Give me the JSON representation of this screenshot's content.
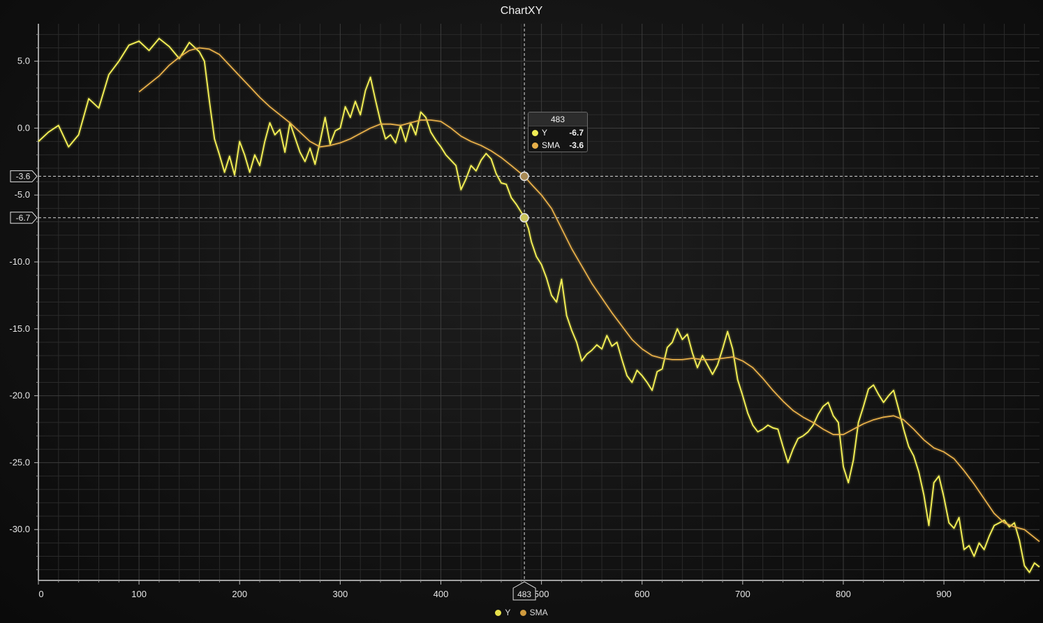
{
  "chart_data": {
    "type": "line",
    "title": "ChartXY",
    "xlim": [
      0,
      995
    ],
    "ylim": [
      -33.8,
      7.8
    ],
    "x_ticks": [
      0,
      100,
      200,
      300,
      400,
      500,
      600,
      700,
      800,
      900
    ],
    "y_ticks": [
      5.0,
      0.0,
      -5.0,
      -10.0,
      -15.0,
      -20.0,
      -25.0,
      -30.0
    ],
    "y_tick_labels": [
      "5.0",
      "0.0",
      "-5.0",
      "-10.0",
      "-15.0",
      "-20.0",
      "-25.0",
      "-30.0"
    ],
    "series": [
      {
        "name": "Y",
        "color": "#f2ee55",
        "points": [
          [
            0,
            -1
          ],
          [
            10,
            -0.3
          ],
          [
            20,
            0.2
          ],
          [
            30,
            -1.4
          ],
          [
            40,
            -0.5
          ],
          [
            50,
            2.2
          ],
          [
            60,
            1.5
          ],
          [
            70,
            4.0
          ],
          [
            80,
            5.0
          ],
          [
            90,
            6.2
          ],
          [
            100,
            6.5
          ],
          [
            110,
            5.8
          ],
          [
            120,
            6.7
          ],
          [
            130,
            6.1
          ],
          [
            140,
            5.2
          ],
          [
            150,
            6.4
          ],
          [
            160,
            5.7
          ],
          [
            165,
            5.0
          ],
          [
            170,
            2.0
          ],
          [
            175,
            -0.8
          ],
          [
            180,
            -2.0
          ],
          [
            185,
            -3.3
          ],
          [
            190,
            -2.1
          ],
          [
            195,
            -3.5
          ],
          [
            200,
            -1.0
          ],
          [
            205,
            -2.0
          ],
          [
            210,
            -3.3
          ],
          [
            215,
            -2.0
          ],
          [
            220,
            -2.8
          ],
          [
            225,
            -1.0
          ],
          [
            230,
            0.4
          ],
          [
            235,
            -0.5
          ],
          [
            240,
            -0.1
          ],
          [
            245,
            -1.8
          ],
          [
            250,
            0.4
          ],
          [
            255,
            -0.7
          ],
          [
            260,
            -1.8
          ],
          [
            265,
            -2.5
          ],
          [
            270,
            -1.5
          ],
          [
            275,
            -2.7
          ],
          [
            280,
            -1.0
          ],
          [
            285,
            0.8
          ],
          [
            290,
            -1.2
          ],
          [
            295,
            -0.2
          ],
          [
            300,
            0.0
          ],
          [
            305,
            1.6
          ],
          [
            310,
            0.8
          ],
          [
            315,
            2.0
          ],
          [
            320,
            1.0
          ],
          [
            325,
            2.8
          ],
          [
            330,
            3.8
          ],
          [
            335,
            2.1
          ],
          [
            340,
            0.5
          ],
          [
            345,
            -0.8
          ],
          [
            350,
            -0.5
          ],
          [
            355,
            -1.1
          ],
          [
            360,
            0.2
          ],
          [
            365,
            -1.0
          ],
          [
            370,
            0.4
          ],
          [
            375,
            -0.5
          ],
          [
            380,
            1.2
          ],
          [
            385,
            0.8
          ],
          [
            390,
            -0.3
          ],
          [
            395,
            -0.9
          ],
          [
            400,
            -1.4
          ],
          [
            405,
            -2.0
          ],
          [
            410,
            -2.4
          ],
          [
            415,
            -2.8
          ],
          [
            420,
            -4.6
          ],
          [
            425,
            -3.8
          ],
          [
            430,
            -2.8
          ],
          [
            435,
            -3.2
          ],
          [
            440,
            -2.4
          ],
          [
            445,
            -1.9
          ],
          [
            450,
            -2.3
          ],
          [
            455,
            -3.4
          ],
          [
            460,
            -4.1
          ],
          [
            465,
            -4.2
          ],
          [
            470,
            -5.2
          ],
          [
            475,
            -5.7
          ],
          [
            480,
            -6.3
          ],
          [
            483,
            -6.7
          ],
          [
            487,
            -7.5
          ],
          [
            490,
            -8.5
          ],
          [
            495,
            -9.6
          ],
          [
            500,
            -10.2
          ],
          [
            505,
            -11.2
          ],
          [
            510,
            -12.5
          ],
          [
            515,
            -13.0
          ],
          [
            520,
            -11.3
          ],
          [
            525,
            -14.0
          ],
          [
            530,
            -15.1
          ],
          [
            535,
            -16.0
          ],
          [
            540,
            -17.4
          ],
          [
            545,
            -16.9
          ],
          [
            550,
            -16.6
          ],
          [
            555,
            -16.2
          ],
          [
            560,
            -16.5
          ],
          [
            565,
            -15.5
          ],
          [
            570,
            -16.3
          ],
          [
            575,
            -16.0
          ],
          [
            580,
            -17.3
          ],
          [
            585,
            -18.5
          ],
          [
            590,
            -19.0
          ],
          [
            595,
            -18.1
          ],
          [
            600,
            -18.5
          ],
          [
            605,
            -19.0
          ],
          [
            610,
            -19.6
          ],
          [
            615,
            -18.2
          ],
          [
            620,
            -18.0
          ],
          [
            625,
            -16.4
          ],
          [
            630,
            -16.0
          ],
          [
            635,
            -15.0
          ],
          [
            640,
            -15.8
          ],
          [
            645,
            -15.4
          ],
          [
            650,
            -16.8
          ],
          [
            655,
            -17.9
          ],
          [
            660,
            -17.0
          ],
          [
            665,
            -17.7
          ],
          [
            670,
            -18.4
          ],
          [
            675,
            -17.7
          ],
          [
            680,
            -16.5
          ],
          [
            685,
            -15.2
          ],
          [
            690,
            -16.5
          ],
          [
            695,
            -18.8
          ],
          [
            700,
            -20.0
          ],
          [
            705,
            -21.3
          ],
          [
            710,
            -22.2
          ],
          [
            715,
            -22.7
          ],
          [
            720,
            -22.5
          ],
          [
            725,
            -22.2
          ],
          [
            730,
            -22.4
          ],
          [
            735,
            -22.5
          ],
          [
            740,
            -23.8
          ],
          [
            745,
            -25.0
          ],
          [
            750,
            -24.0
          ],
          [
            755,
            -23.2
          ],
          [
            760,
            -23.0
          ],
          [
            765,
            -22.7
          ],
          [
            770,
            -22.2
          ],
          [
            775,
            -21.4
          ],
          [
            780,
            -20.8
          ],
          [
            785,
            -20.5
          ],
          [
            790,
            -21.5
          ],
          [
            795,
            -22.0
          ],
          [
            800,
            -25.3
          ],
          [
            805,
            -26.5
          ],
          [
            810,
            -24.8
          ],
          [
            815,
            -22.0
          ],
          [
            820,
            -20.8
          ],
          [
            825,
            -19.5
          ],
          [
            830,
            -19.2
          ],
          [
            835,
            -19.9
          ],
          [
            840,
            -20.5
          ],
          [
            845,
            -20.0
          ],
          [
            850,
            -19.6
          ],
          [
            855,
            -21.0
          ],
          [
            860,
            -22.5
          ],
          [
            865,
            -23.8
          ],
          [
            870,
            -24.5
          ],
          [
            875,
            -25.7
          ],
          [
            880,
            -27.4
          ],
          [
            885,
            -29.7
          ],
          [
            890,
            -26.5
          ],
          [
            895,
            -26.0
          ],
          [
            900,
            -27.6
          ],
          [
            905,
            -29.5
          ],
          [
            910,
            -29.9
          ],
          [
            915,
            -29.1
          ],
          [
            920,
            -31.5
          ],
          [
            925,
            -31.2
          ],
          [
            930,
            -32.0
          ],
          [
            935,
            -31.0
          ],
          [
            940,
            -31.5
          ],
          [
            945,
            -30.5
          ],
          [
            950,
            -29.7
          ],
          [
            955,
            -29.5
          ],
          [
            960,
            -29.3
          ],
          [
            965,
            -29.8
          ],
          [
            970,
            -29.5
          ],
          [
            975,
            -30.8
          ],
          [
            980,
            -32.7
          ],
          [
            985,
            -33.2
          ],
          [
            990,
            -32.5
          ],
          [
            995,
            -32.8
          ]
        ]
      },
      {
        "name": "SMA",
        "color": "#e8b04a",
        "points": [
          [
            100,
            2.7
          ],
          [
            110,
            3.3
          ],
          [
            120,
            3.9
          ],
          [
            130,
            4.7
          ],
          [
            140,
            5.3
          ],
          [
            150,
            5.8
          ],
          [
            160,
            6.0
          ],
          [
            170,
            5.9
          ],
          [
            180,
            5.5
          ],
          [
            190,
            4.7
          ],
          [
            200,
            3.9
          ],
          [
            210,
            3.1
          ],
          [
            220,
            2.3
          ],
          [
            230,
            1.6
          ],
          [
            240,
            1.0
          ],
          [
            250,
            0.4
          ],
          [
            260,
            -0.3
          ],
          [
            270,
            -1.0
          ],
          [
            280,
            -1.4
          ],
          [
            290,
            -1.3
          ],
          [
            300,
            -1.1
          ],
          [
            310,
            -0.8
          ],
          [
            320,
            -0.4
          ],
          [
            330,
            0.0
          ],
          [
            340,
            0.3
          ],
          [
            350,
            0.3
          ],
          [
            360,
            0.2
          ],
          [
            370,
            0.4
          ],
          [
            380,
            0.6
          ],
          [
            390,
            0.6
          ],
          [
            400,
            0.5
          ],
          [
            410,
            0.0
          ],
          [
            420,
            -0.6
          ],
          [
            430,
            -1.0
          ],
          [
            440,
            -1.3
          ],
          [
            450,
            -1.7
          ],
          [
            460,
            -2.2
          ],
          [
            470,
            -2.8
          ],
          [
            483,
            -3.6
          ],
          [
            490,
            -4.2
          ],
          [
            500,
            -5.0
          ],
          [
            510,
            -6.0
          ],
          [
            520,
            -7.5
          ],
          [
            530,
            -9.0
          ],
          [
            540,
            -10.3
          ],
          [
            550,
            -11.6
          ],
          [
            560,
            -12.7
          ],
          [
            570,
            -13.8
          ],
          [
            580,
            -14.8
          ],
          [
            590,
            -15.8
          ],
          [
            600,
            -16.5
          ],
          [
            610,
            -17.0
          ],
          [
            620,
            -17.2
          ],
          [
            630,
            -17.3
          ],
          [
            640,
            -17.3
          ],
          [
            650,
            -17.2
          ],
          [
            660,
            -17.3
          ],
          [
            670,
            -17.3
          ],
          [
            680,
            -17.2
          ],
          [
            690,
            -17.1
          ],
          [
            700,
            -17.4
          ],
          [
            710,
            -17.9
          ],
          [
            720,
            -18.7
          ],
          [
            730,
            -19.6
          ],
          [
            740,
            -20.4
          ],
          [
            750,
            -21.1
          ],
          [
            760,
            -21.6
          ],
          [
            770,
            -22.0
          ],
          [
            780,
            -22.5
          ],
          [
            790,
            -22.9
          ],
          [
            800,
            -22.9
          ],
          [
            810,
            -22.5
          ],
          [
            820,
            -22.1
          ],
          [
            830,
            -21.8
          ],
          [
            840,
            -21.6
          ],
          [
            850,
            -21.5
          ],
          [
            860,
            -21.8
          ],
          [
            870,
            -22.5
          ],
          [
            880,
            -23.3
          ],
          [
            890,
            -23.9
          ],
          [
            900,
            -24.2
          ],
          [
            910,
            -24.7
          ],
          [
            920,
            -25.6
          ],
          [
            930,
            -26.6
          ],
          [
            940,
            -27.7
          ],
          [
            950,
            -28.8
          ],
          [
            960,
            -29.5
          ],
          [
            970,
            -29.8
          ],
          [
            980,
            -30.0
          ],
          [
            990,
            -30.6
          ],
          [
            995,
            -30.9
          ]
        ]
      }
    ],
    "cursor": {
      "x": 483,
      "x_label": "483",
      "y_labels": [
        {
          "value": -3.6,
          "text": "-3.6"
        },
        {
          "value": -6.7,
          "text": "-6.7"
        }
      ]
    },
    "tooltip": {
      "header": "483",
      "rows": [
        {
          "name": "Y",
          "value": "-6.7",
          "color": "#f2ee55"
        },
        {
          "name": "SMA",
          "value": "-3.6",
          "color": "#e8b04a"
        }
      ]
    },
    "legend": [
      {
        "name": "Y",
        "color": "#e6e04a"
      },
      {
        "name": "SMA",
        "color": "#cf9a3e"
      }
    ],
    "grid": true,
    "legend_position": "bottom"
  }
}
